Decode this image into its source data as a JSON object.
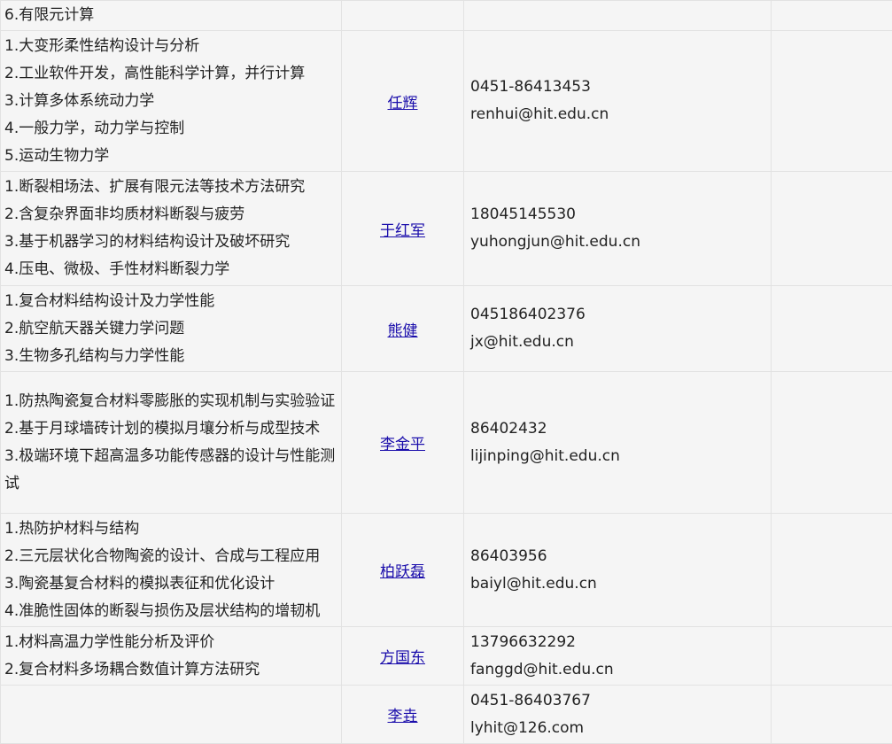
{
  "rows": [
    {
      "research": [
        "6.有限元计算"
      ],
      "name": "",
      "phone": "",
      "email": ""
    },
    {
      "research": [
        "1.大变形柔性结构设计与分析",
        "2.工业软件开发，高性能科学计算，并行计算",
        "3.计算多体系统动力学",
        "4.一般力学，动力学与控制",
        "5.运动生物力学"
      ],
      "name": "任辉",
      "phone": "0451-86413453",
      "email": "renhui@hit.edu.cn"
    },
    {
      "research": [
        "1.断裂相场法、扩展有限元法等技术方法研究",
        "2.含复杂界面非均质材料断裂与疲劳",
        "3.基于机器学习的材料结构设计及破坏研究",
        "4.压电、微极、手性材料断裂力学"
      ],
      "name": "于红军",
      "phone": "18045145530",
      "email": "yuhongjun@hit.edu.cn"
    },
    {
      "research": [
        "1.复合材料结构设计及力学性能",
        "2.航空航天器关键力学问题",
        "3.生物多孔结构与力学性能"
      ],
      "name": "熊健",
      "phone": "045186402376",
      "email": "jx@hit.edu.cn"
    },
    {
      "research": [
        "1.防热陶瓷复合材料零膨胀的实现机制与实验验证",
        "2.基于月球墙砖计划的模拟月壤分析与成型技术",
        "3.极端环境下超高温多功能传感器的设计与性能测试"
      ],
      "name": "李金平",
      "phone": "86402432",
      "email": "lijinping@hit.edu.cn"
    },
    {
      "research": [
        "1.热防护材料与结构",
        "2.三元层状化合物陶瓷的设计、合成与工程应用",
        "3.陶瓷基复合材料的模拟表征和优化设计",
        "4.准脆性固体的断裂与损伤及层状结构的增韧机"
      ],
      "name": "柏跃磊",
      "phone": "86403956",
      "email": "baiyl@hit.edu.cn"
    },
    {
      "research": [
        "1.材料高温力学性能分析及评价",
        "2.复合材料多场耦合数值计算方法研究"
      ],
      "name": "方国东",
      "phone": "13796632292",
      "email": "fanggd@hit.edu.cn"
    },
    {
      "research": [],
      "name": "李垚",
      "phone": "0451-86403767",
      "email": "lyhit@126.com"
    }
  ]
}
